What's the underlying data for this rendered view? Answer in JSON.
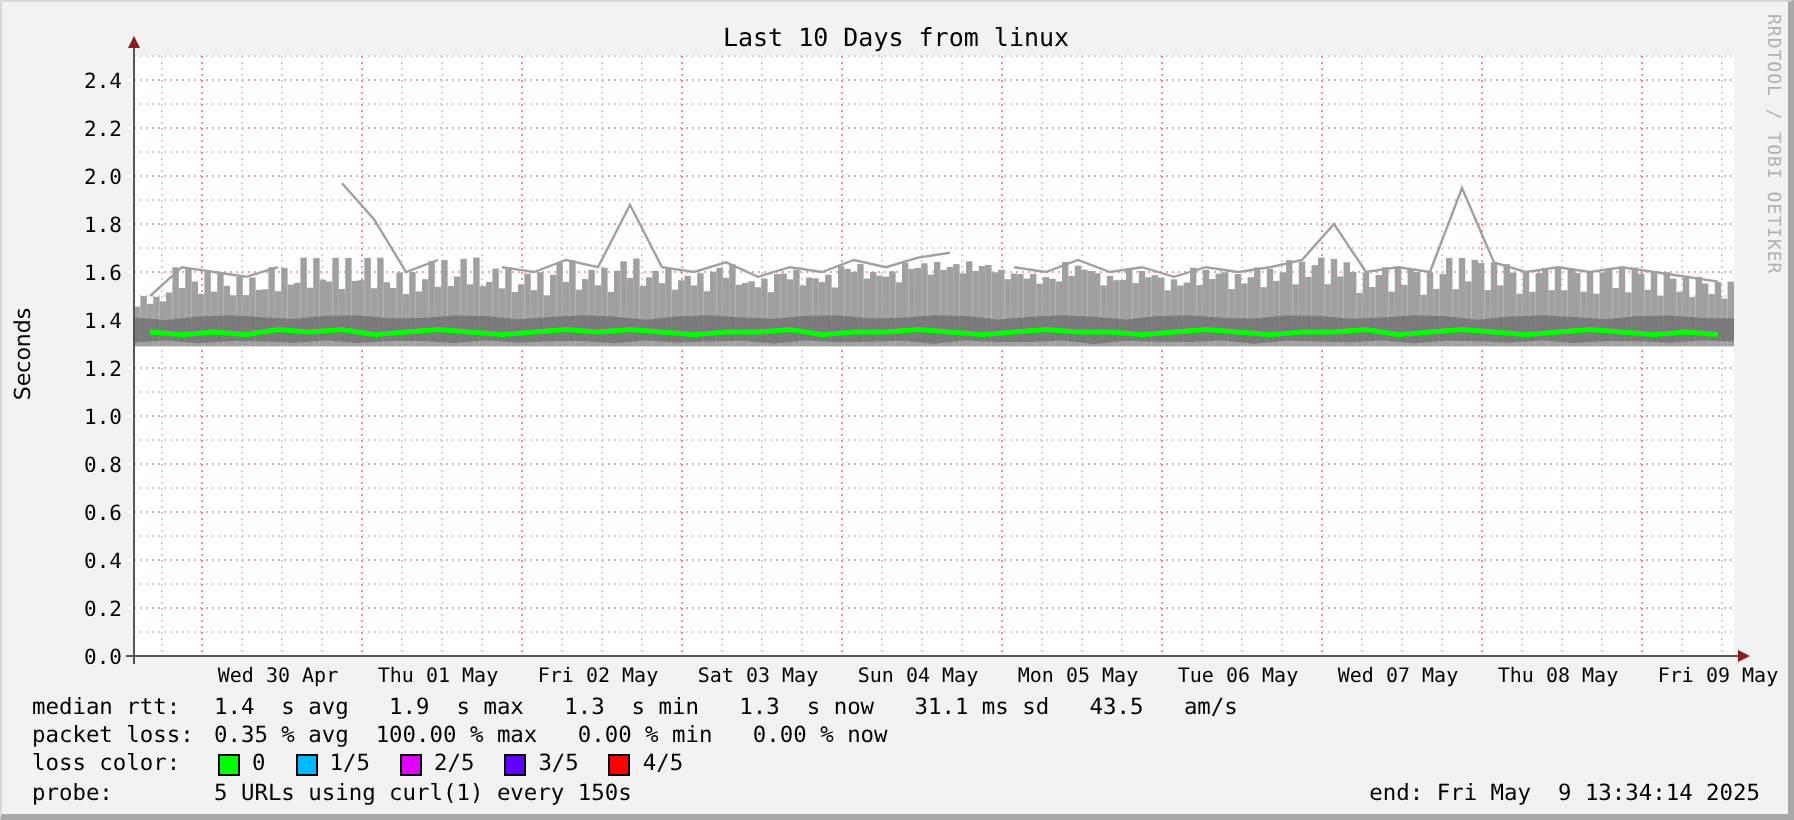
{
  "chart": {
    "credit": "RRDTOOL / TOBI OETIKER",
    "chart_data": {
      "type": "line",
      "grid": true,
      "title": "Last 10 Days from linux",
      "ylabel": "Seconds",
      "ylim": [
        0,
        2.5
      ],
      "yticks": [
        {
          "value": 0,
          "label": "0.0"
        },
        {
          "value": 0.2,
          "label": "0.2"
        },
        {
          "value": 0.4,
          "label": "0.4"
        },
        {
          "value": 0.6,
          "label": "0.6"
        },
        {
          "value": 0.8,
          "label": "0.8"
        },
        {
          "value": 1,
          "label": "1.0"
        },
        {
          "value": 1.2,
          "label": "1.2"
        },
        {
          "value": 1.4,
          "label": "1.4"
        },
        {
          "value": 1.6,
          "label": "1.6"
        },
        {
          "value": 1.8,
          "label": "1.8"
        },
        {
          "value": 2,
          "label": "2.0"
        },
        {
          "value": 2.2,
          "label": "2.2"
        },
        {
          "value": 2.4,
          "label": "2.4"
        }
      ],
      "categories": [
        null,
        null,
        null,
        null,
        "Wed 30 Apr",
        null,
        null,
        null,
        null,
        "Thu 01 May",
        null,
        null,
        null,
        null,
        "Fri 02 May",
        null,
        null,
        null,
        null,
        "Sat 03 May",
        null,
        null,
        null,
        null,
        "Sun 04 May",
        null,
        null,
        null,
        null,
        "Mon 05 May",
        null,
        null,
        null,
        null,
        "Tue 06 May",
        null,
        null,
        null,
        null,
        "Wed 07 May",
        null,
        null,
        null,
        null,
        "Thu 08 May",
        null,
        null,
        null,
        null,
        "Fri 09 May"
      ],
      "series": [
        {
          "color": "#a0a0a0",
          "values": [
            1.5,
            1.62,
            1.6,
            1.58,
            1.62,
            null,
            1.97,
            1.82,
            1.6,
            1.65,
            null,
            1.62,
            1.6,
            1.65,
            1.62,
            1.88,
            1.62,
            1.6,
            1.64,
            1.58,
            1.62,
            1.6,
            1.65,
            1.62,
            1.66,
            1.68,
            null,
            1.62,
            1.6,
            1.65,
            1.6,
            1.62,
            1.58,
            1.62,
            1.6,
            1.62,
            1.65,
            1.8,
            1.6,
            1.62,
            1.6,
            1.95,
            1.64,
            1.6,
            1.62,
            1.6,
            1.62,
            1.6,
            1.58,
            1.56
          ]
        },
        {
          "name": "median rtt:",
          "color": "#00ff00",
          "values": [
            1.35,
            1.34,
            1.35,
            1.34,
            1.36,
            1.35,
            1.36,
            1.34,
            1.35,
            1.36,
            1.35,
            1.34,
            1.35,
            1.36,
            1.35,
            1.36,
            1.35,
            1.34,
            1.35,
            1.35,
            1.36,
            1.34,
            1.35,
            1.35,
            1.36,
            1.35,
            1.34,
            1.35,
            1.36,
            1.35,
            1.35,
            1.34,
            1.35,
            1.36,
            1.35,
            1.34,
            1.35,
            1.35,
            1.36,
            1.34,
            1.35,
            1.36,
            1.35,
            1.34,
            1.35,
            1.36,
            1.35,
            1.34,
            1.35,
            1.34
          ]
        }
      ]
    }
  },
  "legend": {
    "rows": [
      {
        "text": "1.4  s avg   1.9  s max   1.3  s min   1.3  s now   31.1 ms sd   43.5   am/s"
      },
      {
        "label": "packet loss:",
        "text": "0.35 % avg  100.00 % max   0.00 % min   0.00 % now"
      }
    ],
    "loss_color": {
      "label": "loss color:",
      "items": [
        {
          "label": "0",
          "color": "#00ff00"
        },
        {
          "label": "1/5",
          "color": "#00b8ff"
        },
        {
          "label": "2/5",
          "color": "#e000ff"
        },
        {
          "label": "3/5",
          "color": "#6000ff"
        },
        {
          "label": "4/5",
          "color": "#ff0000"
        }
      ]
    },
    "probe": {
      "label": "probe:",
      "text": "5 URLs using curl(1) every 150s"
    },
    "end": "end: Fri May  9 13:34:14 2025"
  }
}
